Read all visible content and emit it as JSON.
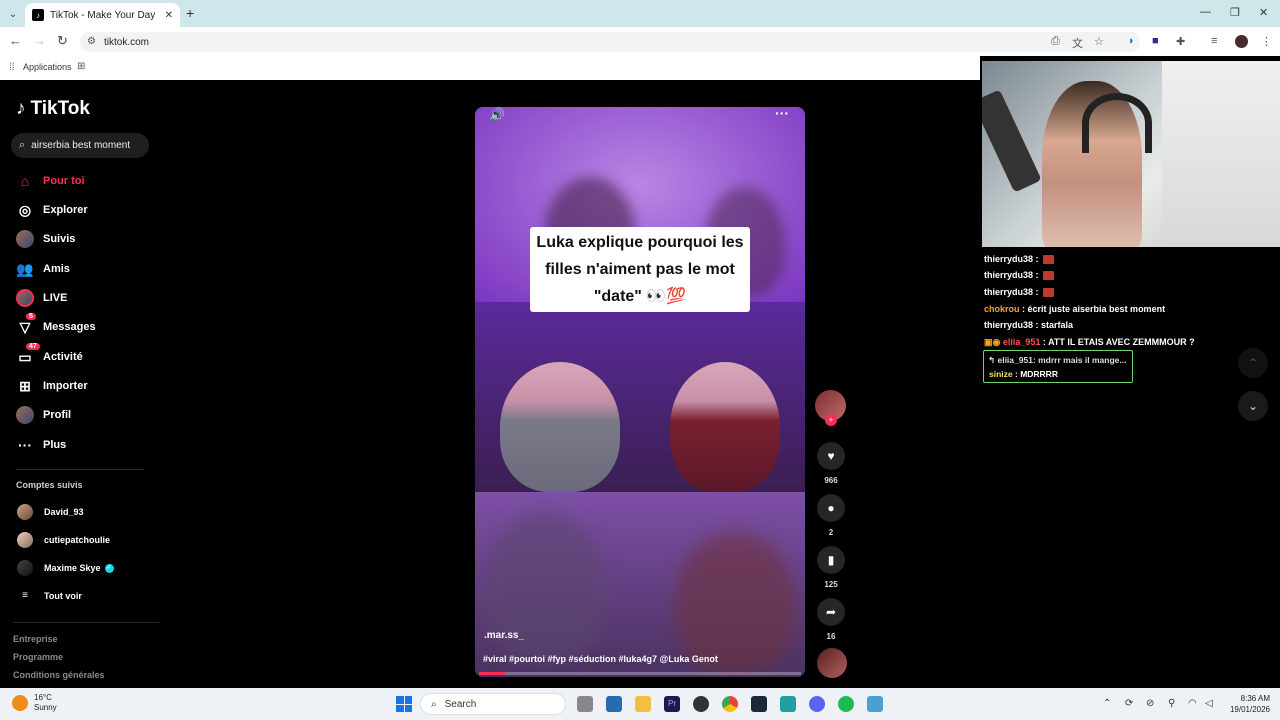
{
  "browser": {
    "tab_title": "TikTok - Make Your Day",
    "tab_icon": "tiktok-icon",
    "url": "tiktok.com",
    "bookmarks_label": "Applications"
  },
  "sidebar": {
    "logo": "TikTok",
    "search_value": "airserbia best moment",
    "nav": [
      {
        "label": "Pour toi",
        "icon": "home-icon",
        "active": true
      },
      {
        "label": "Explorer",
        "icon": "compass-icon"
      },
      {
        "label": "Suivis",
        "icon": "avatar"
      },
      {
        "label": "Amis",
        "icon": "friends-icon"
      },
      {
        "label": "LIVE",
        "icon": "live-avatar"
      },
      {
        "label": "Messages",
        "icon": "send-icon",
        "badge": "5"
      },
      {
        "label": "Activité",
        "icon": "inbox-icon",
        "badge": "47"
      },
      {
        "label": "Importer",
        "icon": "upload-icon"
      },
      {
        "label": "Profil",
        "icon": "avatar"
      },
      {
        "label": "Plus",
        "icon": "more-icon"
      }
    ],
    "following_title": "Comptes suivis",
    "following": [
      {
        "name": "David_93"
      },
      {
        "name": "cutiepatchoulie"
      },
      {
        "name": "Maxime Skye",
        "verified": true
      }
    ],
    "see_all": "Tout voir",
    "footer": [
      "Entreprise",
      "Programme",
      "Conditions générales"
    ]
  },
  "video": {
    "caption": "Luka explique pourquoi les filles n'aiment pas le mot \"date\" 👀💯",
    "author": ".mar.ss_",
    "tags": "#viral #pourtoi #fyp #séduction #luka4g7 @Luka Genot",
    "progress": 0.08,
    "likes": "966",
    "comments": "2",
    "saves": "125",
    "shares": "16"
  },
  "chat": {
    "lines": [
      {
        "user": "thierrydu38",
        "text": "",
        "emote": true,
        "style": "u"
      },
      {
        "user": "thierrydu38",
        "text": "",
        "emote": true,
        "style": "u"
      },
      {
        "user": "thierrydu38",
        "text": "",
        "emote": true,
        "style": "u"
      },
      {
        "user": "chokrou",
        "text": "écrit juste aiserbia best moment",
        "style": "u-orange"
      },
      {
        "user": "thierrydu38",
        "text": "starfala",
        "style": "u"
      },
      {
        "user": "eliia_951",
        "text": "ATT IL ETAIS AVEC ZEMMMOUR ?",
        "style": "u-red"
      }
    ],
    "reply_quote": "eliia_951: mdrrr mais il mange...",
    "reply_user": "sinize",
    "reply_text": "MDRRRR"
  },
  "taskbar": {
    "temp": "16°C",
    "weather": "Sunny",
    "search": "Search",
    "time": "8:36 AM",
    "date": "19/01/2026"
  }
}
